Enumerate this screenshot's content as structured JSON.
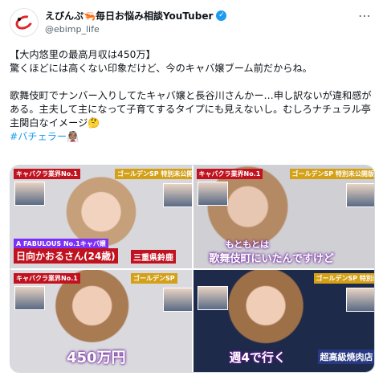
{
  "author": {
    "display_name": "えびんぷ🦐毎日お悩み相談YouTuber",
    "handle": "@ebimp_life",
    "verified": true
  },
  "post": {
    "text": "【大内悠里の最高月収は450万】\n驚くほどには高くない印象だけど、今のキャバ嬢ブーム前だからね。\n\n歌舞伎町でナンバー入りしてたキャバ嬢と長谷川さんかー…申し訳ないが違和感がある。主夫して主になって子育てするタイプにも見えないし。むしろナチュラル亭主関白なイメージ🤔",
    "hashtag": "#バチェラー👰🏽"
  },
  "media": {
    "tile1": {
      "top_label": "キャバクラ業界No.1",
      "top_right_label": "ゴールデンSP 特別未公開版",
      "bottom_small": "A FABULOUS  No.1キャバ嬢",
      "bottom_name": "日向かおるさん(24歳)",
      "bottom_place": "三重県鈴鹿"
    },
    "tile2": {
      "top_label": "キャバクラ業界No.1",
      "top_right_label": "ゴールデンSP 特別未公開版",
      "subtitle": "もともとは",
      "subtitle2": "歌舞伎町にいたんですけど"
    },
    "tile3": {
      "top_label": "キャバクラ業界No.1",
      "top_right_label": "ゴールデンSP",
      "subtitle": "450万円"
    },
    "tile4": {
      "top_right_label": "ゴールデンSP 特別未公開版",
      "subtitle": "週4で行く",
      "sign": "超高級焼肉店"
    }
  },
  "colors": {
    "verified": "#1d9bf0",
    "hashtag": "#1d9bf0",
    "handle": "#536471"
  }
}
